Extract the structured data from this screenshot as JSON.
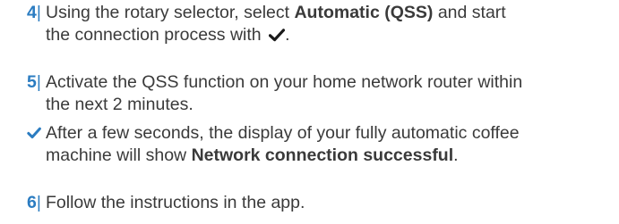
{
  "steps": [
    {
      "number": "4",
      "separator": "|",
      "line1_pre": "Using the rotary selector, select ",
      "line1_bold": "Automatic (QSS)",
      "line1_post": " and start",
      "line2_pre": "the connection process with ",
      "line2_icon": "checkmark-icon",
      "line2_post": "."
    },
    {
      "number": "5",
      "separator": "|",
      "line1": "Activate the QSS function on your home network router within",
      "line2": "the next 2 minutes."
    },
    {
      "number": "6",
      "separator": "|",
      "line1": "Follow the instructions in the app."
    }
  ],
  "result": {
    "icon": "checkmark-icon",
    "line1": "After a few seconds, the display of your fully automatic coffee",
    "line2_pre": "machine will show ",
    "line2_bold": "Network connection successful",
    "line2_post": "."
  },
  "colors": {
    "accent": "#2b7cc1",
    "text": "#3a3a3a",
    "icon": "#1b1b1b"
  }
}
